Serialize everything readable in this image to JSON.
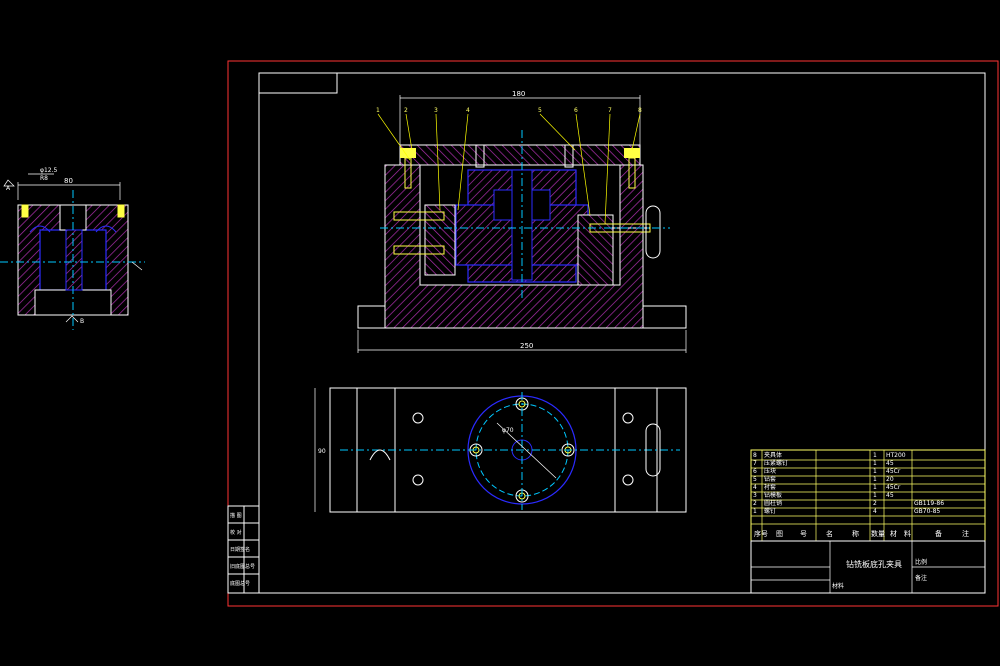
{
  "drawing": {
    "title": "钻铣板底孔夹具",
    "background": "#000000",
    "colors": {
      "frame": "#ff3333",
      "outline": "#ffffff",
      "part": "#2b2bff",
      "hatch": "#b030b0",
      "center": "#00c8ff",
      "fastener": "#ffff44",
      "leader": "#ffff00"
    }
  },
  "dimensions": {
    "top_width": "180",
    "base_width": "250",
    "small_view_width": "80",
    "small_view_top": "R8",
    "small_view_label": "φ12.5",
    "dia_label": "φ70",
    "height_label": "90",
    "side_a": "A",
    "side_b": "B"
  },
  "balloons": [
    "1",
    "2",
    "3",
    "4",
    "5",
    "6",
    "7",
    "8"
  ],
  "bom": {
    "rows": [
      {
        "no": "8",
        "name": "夹具体",
        "qty": "1",
        "material": "HT200",
        "note": ""
      },
      {
        "no": "7",
        "name": "压紧螺钉",
        "qty": "1",
        "material": "45",
        "note": ""
      },
      {
        "no": "6",
        "name": "压块",
        "qty": "1",
        "material": "45Cr",
        "note": ""
      },
      {
        "no": "5",
        "name": "钻套",
        "qty": "1",
        "material": "20",
        "note": ""
      },
      {
        "no": "4",
        "name": "衬套",
        "qty": "1",
        "material": "45Cr",
        "note": ""
      },
      {
        "no": "3",
        "name": "钻模板",
        "qty": "1",
        "material": "45",
        "note": ""
      },
      {
        "no": "2",
        "name": "圆柱销",
        "qty": "2",
        "material": "",
        "note": "GB119-86"
      },
      {
        "no": "1",
        "name": "螺钉",
        "qty": "4",
        "material": "",
        "note": "GB70-85"
      }
    ],
    "header": [
      "序号",
      "图",
      "号",
      "名",
      "称",
      "数量",
      "材",
      "料",
      "备",
      "注"
    ],
    "title_cell": "钻铣板底孔夹具",
    "scale_label": "比例",
    "material_label": "材料",
    "note_label": "备注"
  },
  "left_strip": [
    "描 图",
    "校 对",
    "日期签名",
    "旧底图总号",
    "底图总号"
  ]
}
